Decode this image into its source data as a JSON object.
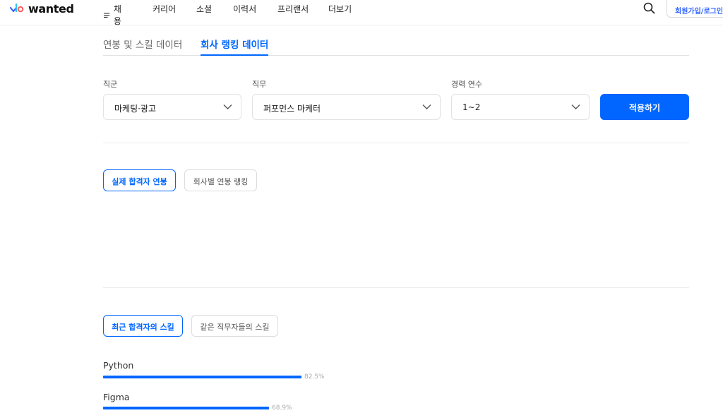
{
  "header": {
    "logo_text": "wanted",
    "nav": [
      {
        "label": "채용"
      },
      {
        "label": "커리어"
      },
      {
        "label": "소셜"
      },
      {
        "label": "이력서"
      },
      {
        "label": "프리랜서"
      },
      {
        "label": "더보기"
      }
    ],
    "login_label": "회원가입/로그인"
  },
  "tabs": [
    {
      "label": "연봉 및 스킬 데이터",
      "active": false
    },
    {
      "label": "회사 랭킹 데이터",
      "active": true
    }
  ],
  "filters": {
    "category": {
      "label": "직군",
      "value": "마케팅·광고"
    },
    "job": {
      "label": "직무",
      "value": "퍼포먼스 마케터"
    },
    "experience": {
      "label": "경력 연수",
      "value": "1~2"
    },
    "apply_label": "적용하기"
  },
  "salary_chips": [
    {
      "label": "실제 합격자 연봉",
      "active": true
    },
    {
      "label": "회사별 연봉 랭킹",
      "active": false
    }
  ],
  "skill_chips": [
    {
      "label": "최근 합격자의 스킬",
      "active": true
    },
    {
      "label": "같은 직무자들의 스킬",
      "active": false
    }
  ],
  "skills": [
    {
      "name": "Python",
      "percent": 82.5,
      "percent_label": "82.5%"
    },
    {
      "name": "Figma",
      "percent": 68.9,
      "percent_label": "68.9%"
    }
  ],
  "colors": {
    "accent": "#0066ff",
    "login_text": "#3366ff"
  }
}
